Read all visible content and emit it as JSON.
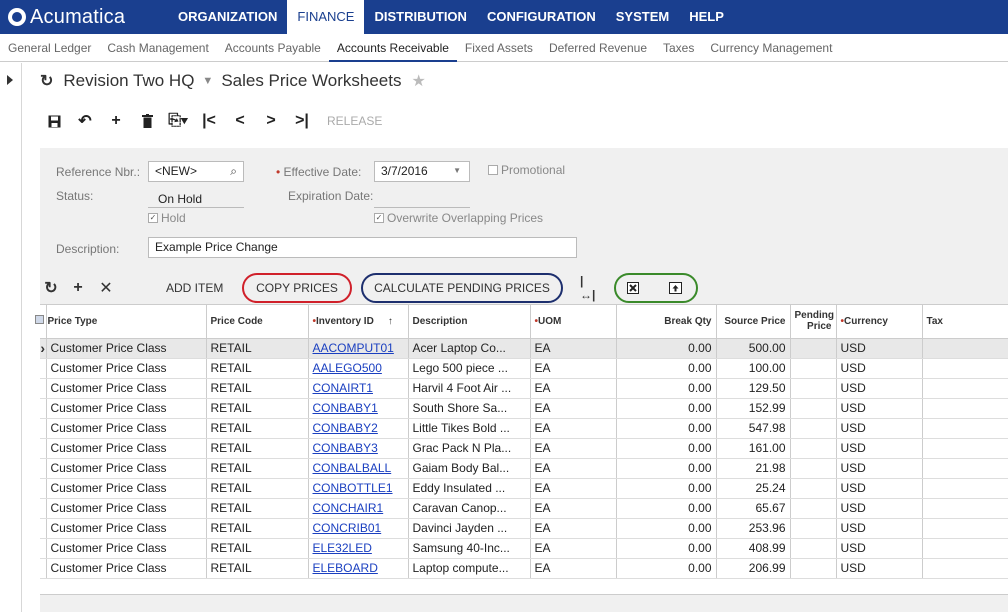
{
  "app": {
    "logo_text": "Acumatica",
    "brand_color": "#1a3f8f"
  },
  "topnav": [
    {
      "label": "ORGANIZATION",
      "active": false
    },
    {
      "label": "FINANCE",
      "active": true
    },
    {
      "label": "DISTRIBUTION",
      "active": false
    },
    {
      "label": "CONFIGURATION",
      "active": false
    },
    {
      "label": "SYSTEM",
      "active": false
    },
    {
      "label": "HELP",
      "active": false
    }
  ],
  "subnav": [
    {
      "label": "General Ledger",
      "active": false
    },
    {
      "label": "Cash Management",
      "active": false
    },
    {
      "label": "Accounts Payable",
      "active": false
    },
    {
      "label": "Accounts Receivable",
      "active": true
    },
    {
      "label": "Fixed Assets",
      "active": false
    },
    {
      "label": "Deferred Revenue",
      "active": false
    },
    {
      "label": "Taxes",
      "active": false
    },
    {
      "label": "Currency Management",
      "active": false
    }
  ],
  "title": {
    "company": "Revision Two HQ",
    "screen": "Sales Price Worksheets"
  },
  "toolbar": {
    "release_label": "RELEASE"
  },
  "form": {
    "reference_nbr_label": "Reference Nbr.:",
    "reference_nbr_value": "<NEW>",
    "status_label": "Status:",
    "status_value": "On Hold",
    "hold_label": "Hold",
    "effective_date_label": "Effective Date:",
    "effective_date_value": "3/7/2016",
    "expiration_date_label": "Expiration Date:",
    "promotional_label": "Promotional",
    "overwrite_label": "Overwrite Overlapping Prices",
    "description_label": "Description:",
    "description_value": "Example Price Change"
  },
  "grid_toolbar": {
    "add_item": "ADD ITEM",
    "copy_prices": "COPY PRICES",
    "calculate_pending_prices": "CALCULATE PENDING PRICES",
    "copy_highlight_color": "#d0202a",
    "calc_highlight_color": "#1d2f6e",
    "export_highlight_color": "#3a8a2a"
  },
  "grid": {
    "columns": [
      "Price Type",
      "Price Code",
      "Inventory ID",
      "Description",
      "UOM",
      "Break Qty",
      "Source Price",
      "Pending Price",
      "Currency",
      "Tax"
    ],
    "rows": [
      [
        "Customer Price Class",
        "RETAIL",
        "AACOMPUT01",
        "Acer Laptop Co...",
        "EA",
        "0.00",
        "500.00",
        "",
        "USD",
        ""
      ],
      [
        "Customer Price Class",
        "RETAIL",
        "AALEGO500",
        "Lego 500 piece ...",
        "EA",
        "0.00",
        "100.00",
        "",
        "USD",
        ""
      ],
      [
        "Customer Price Class",
        "RETAIL",
        "CONAIRT1",
        "Harvil 4 Foot Air ...",
        "EA",
        "0.00",
        "129.50",
        "",
        "USD",
        ""
      ],
      [
        "Customer Price Class",
        "RETAIL",
        "CONBABY1",
        "South Shore Sa...",
        "EA",
        "0.00",
        "152.99",
        "",
        "USD",
        ""
      ],
      [
        "Customer Price Class",
        "RETAIL",
        "CONBABY2",
        "Little Tikes Bold ...",
        "EA",
        "0.00",
        "547.98",
        "",
        "USD",
        ""
      ],
      [
        "Customer Price Class",
        "RETAIL",
        "CONBABY3",
        "Grac Pack N Pla...",
        "EA",
        "0.00",
        "161.00",
        "",
        "USD",
        ""
      ],
      [
        "Customer Price Class",
        "RETAIL",
        "CONBALBALL",
        "Gaiam Body Bal...",
        "EA",
        "0.00",
        "21.98",
        "",
        "USD",
        ""
      ],
      [
        "Customer Price Class",
        "RETAIL",
        "CONBOTTLE1",
        "Eddy Insulated ...",
        "EA",
        "0.00",
        "25.24",
        "",
        "USD",
        ""
      ],
      [
        "Customer Price Class",
        "RETAIL",
        "CONCHAIR1",
        "Caravan Canop...",
        "EA",
        "0.00",
        "65.67",
        "",
        "USD",
        ""
      ],
      [
        "Customer Price Class",
        "RETAIL",
        "CONCRIB01",
        "Davinci Jayden ...",
        "EA",
        "0.00",
        "253.96",
        "",
        "USD",
        ""
      ],
      [
        "Customer Price Class",
        "RETAIL",
        "ELE32LED",
        "Samsung 40-Inc...",
        "EA",
        "0.00",
        "408.99",
        "",
        "USD",
        ""
      ],
      [
        "Customer Price Class",
        "RETAIL",
        "ELEBOARD",
        "Laptop compute...",
        "EA",
        "0.00",
        "206.99",
        "",
        "USD",
        ""
      ]
    ]
  }
}
